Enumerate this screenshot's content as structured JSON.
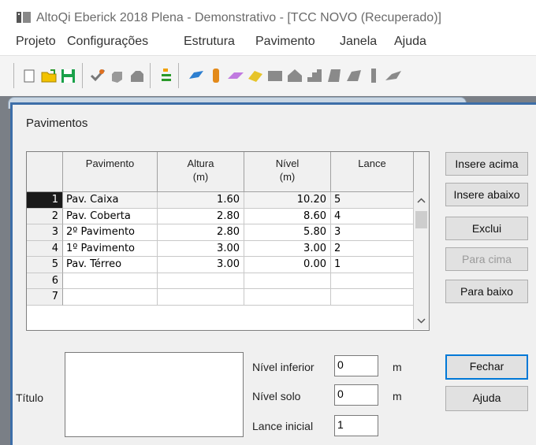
{
  "window": {
    "title": "AltoQi Eberick 2018 Plena - Demonstrativo - [TCC NOVO (Recuperado)]"
  },
  "menu": [
    "Projeto",
    "Configurações",
    "Estrutura",
    "Pavimento",
    "Janela",
    "Ajuda"
  ],
  "toolbar_icons": [
    "new-document-icon",
    "open-folder-icon",
    "save-icon",
    "check-icon",
    "hand-icon",
    "printer-icon",
    "hierarchy-icon",
    "beam-icon",
    "column-icon",
    "slab-icon",
    "foundation-icon",
    "wall-icon",
    "stair-icon",
    "stair2-icon",
    "stair3-icon",
    "pillar-icon",
    "pillar2-icon",
    "element-icon"
  ],
  "dialog": {
    "title": "Pavimentos",
    "columns": [
      {
        "label": "Pavimento",
        "unit": ""
      },
      {
        "label": "Altura",
        "unit": "(m)"
      },
      {
        "label": "Nível",
        "unit": "(m)"
      },
      {
        "label": "Lance",
        "unit": ""
      }
    ],
    "rows": [
      {
        "num": "1",
        "pavimento": "Pav. Caixa",
        "altura": "1.60",
        "nivel": "10.20",
        "lance": "5",
        "selected": true
      },
      {
        "num": "2",
        "pavimento": "Pav. Coberta",
        "altura": "2.80",
        "nivel": "8.60",
        "lance": "4"
      },
      {
        "num": "3",
        "pavimento": "2º Pavimento",
        "altura": "2.80",
        "nivel": "5.80",
        "lance": "3"
      },
      {
        "num": "4",
        "pavimento": "1º Pavimento",
        "altura": "3.00",
        "nivel": "3.00",
        "lance": "2"
      },
      {
        "num": "5",
        "pavimento": "Pav. Térreo",
        "altura": "3.00",
        "nivel": "0.00",
        "lance": "1"
      },
      {
        "num": "6",
        "pavimento": "",
        "altura": "",
        "nivel": "",
        "lance": ""
      },
      {
        "num": "7",
        "pavimento": "",
        "altura": "",
        "nivel": "",
        "lance": ""
      }
    ],
    "buttons": {
      "insere_acima": "Insere acima",
      "insere_abaixo": "Insere abaixo",
      "exclui": "Exclui",
      "para_cima": "Para cima",
      "para_baixo": "Para baixo",
      "fechar": "Fechar",
      "ajuda": "Ajuda"
    },
    "titulo_label": "Título",
    "nivel_inferior": {
      "label": "Nível inferior",
      "value": "0",
      "unit": "m"
    },
    "nivel_solo": {
      "label": "Nível solo",
      "value": "0",
      "unit": "m"
    },
    "lance_inicial": {
      "label": "Lance inicial",
      "value": "1"
    }
  },
  "colors": {
    "accent": "#0078d7",
    "selected_row_header": "#1a1a1a",
    "dialog_border": "#3d6ea8"
  }
}
